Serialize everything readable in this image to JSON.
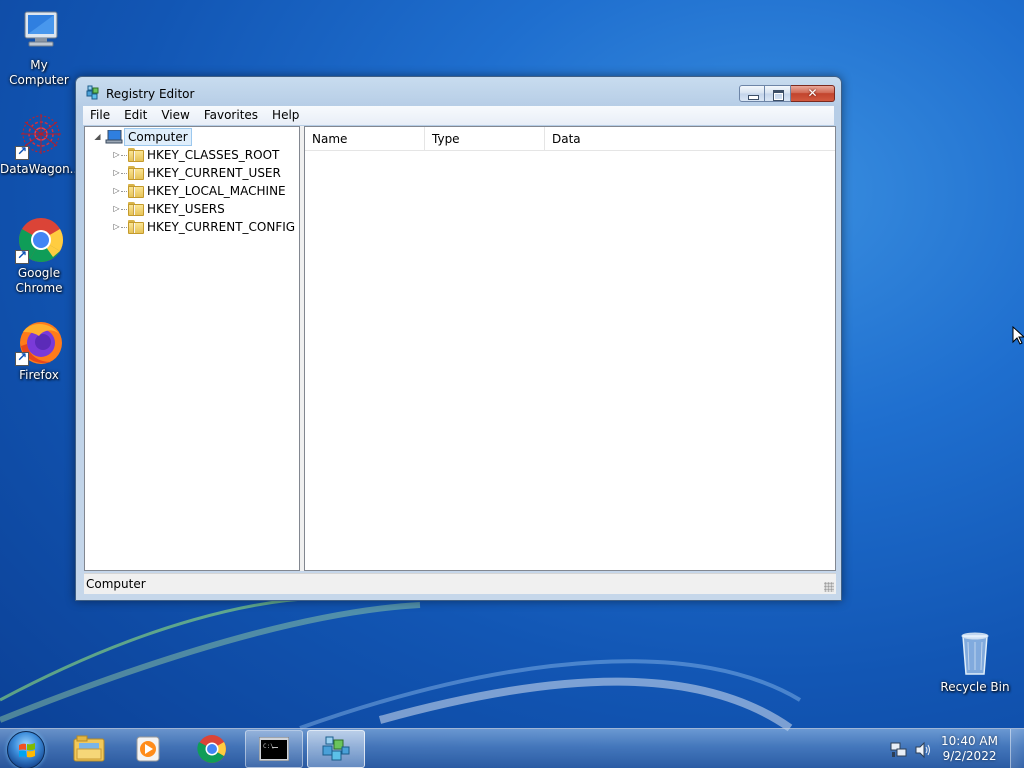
{
  "desktop": {
    "icons": [
      {
        "label": "My Computer"
      },
      {
        "label": "DataWagon..."
      },
      {
        "label": "Google Chrome"
      },
      {
        "label": "Firefox"
      },
      {
        "label": "Recycle Bin"
      }
    ]
  },
  "window": {
    "title": "Registry Editor",
    "menu": [
      "File",
      "Edit",
      "View",
      "Favorites",
      "Help"
    ],
    "tree": {
      "root": "Computer",
      "keys": [
        "HKEY_CLASSES_ROOT",
        "HKEY_CURRENT_USER",
        "HKEY_LOCAL_MACHINE",
        "HKEY_USERS",
        "HKEY_CURRENT_CONFIG"
      ]
    },
    "columns": [
      "Name",
      "Type",
      "Data"
    ],
    "status": "Computer"
  },
  "taskbar": {
    "time": "10:40 AM",
    "date": "9/2/2022"
  },
  "icons": {
    "start": "windows-logo-icon",
    "explorer": "folder-icon",
    "media": "media-player-icon",
    "chrome": "chrome-icon",
    "cmd": "command-prompt-icon",
    "regedit": "registry-editor-icon"
  },
  "colors": {
    "desktop_blue": "#1256b4",
    "close_red": "#c2442d",
    "selection": "#dfeefb"
  }
}
